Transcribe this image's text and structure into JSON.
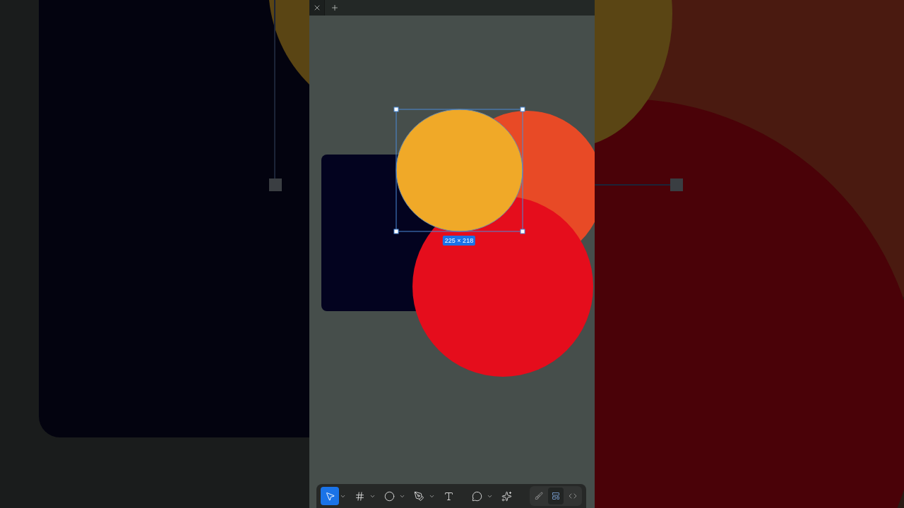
{
  "tab_bar": {
    "tabs": [
      {
        "kind": "close"
      },
      {
        "kind": "add"
      }
    ]
  },
  "canvas": {
    "selection": {
      "dimensions": "225 × 218"
    }
  },
  "toolbar": {
    "tools": [
      {
        "kind": "move",
        "selected": true,
        "dropdown": true
      },
      {
        "kind": "frame",
        "selected": false,
        "dropdown": true
      },
      {
        "kind": "ellipse",
        "selected": false,
        "dropdown": true
      },
      {
        "kind": "pen",
        "selected": false,
        "dropdown": true
      },
      {
        "kind": "text",
        "selected": false,
        "dropdown": false
      },
      {
        "kind": "comment",
        "selected": false,
        "dropdown": true
      },
      {
        "kind": "actions",
        "selected": false,
        "dropdown": false
      }
    ],
    "modes": [
      {
        "kind": "draw",
        "selected": false
      },
      {
        "kind": "design",
        "selected": true
      },
      {
        "kind": "dev",
        "selected": false
      }
    ]
  }
}
